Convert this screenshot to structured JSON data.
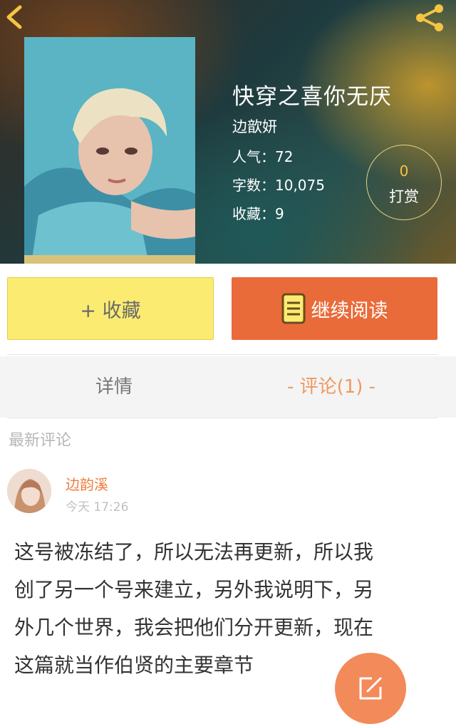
{
  "nav": {
    "back_icon": "back-chevron-icon",
    "share_icon": "share-icon"
  },
  "book": {
    "title": "快穿之喜你无厌",
    "author": "边歆妍",
    "popularity": "人气：72",
    "word_count": "字数：10,075",
    "favorites": "收藏：9"
  },
  "tip": {
    "count": "0",
    "label": "打赏"
  },
  "actions": {
    "favorite_label": "+ 收藏",
    "continue_reading_label": "继续阅读",
    "continue_icon": "book-icon"
  },
  "tabs": {
    "detail": "详情",
    "comments": "- 评论(1) -"
  },
  "comments_section": {
    "label": "最新评论",
    "items": [
      {
        "user": "边韵溪",
        "time": "今天 17:26",
        "lines": [
          "这号被冻结了，所以无法再更新，所以我",
          "创了另一个号来建立，另外我说明下，另",
          "外几个世界，我会把他们分开更新，现在",
          "这篇就当作伯贤的主要章节"
        ]
      }
    ]
  },
  "fab": {
    "icon": "edit-icon"
  },
  "colors": {
    "accent_orange": "#ea6b3a",
    "favorite_yellow": "#fbec71",
    "tab_active": "#f09860",
    "commenter": "#f07d3c"
  }
}
